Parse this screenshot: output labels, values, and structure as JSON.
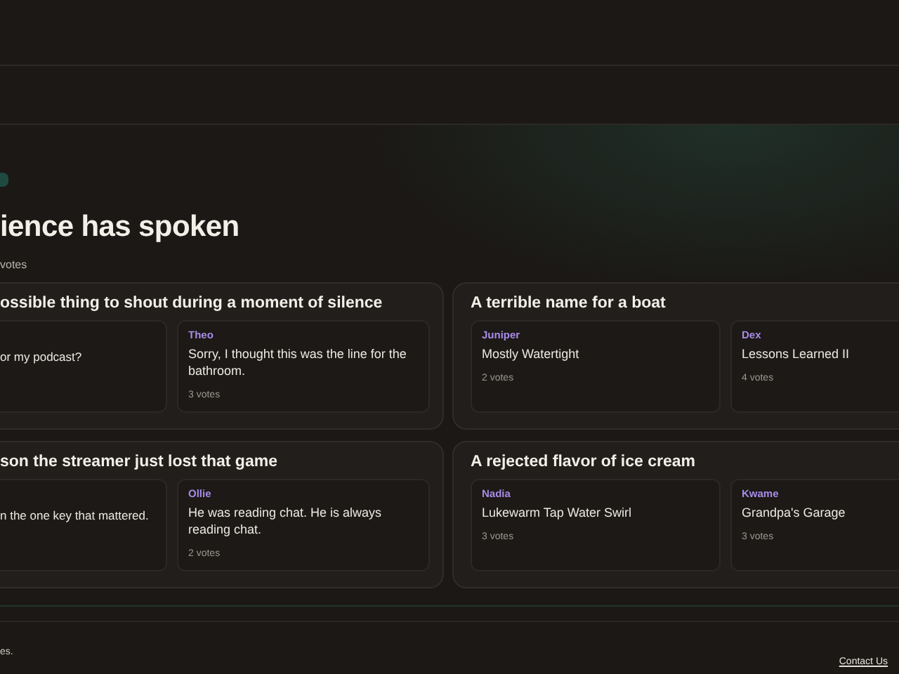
{
  "hero": {
    "title": "ience has spoken",
    "subtitle": "votes"
  },
  "prompts": [
    {
      "title": "ossible thing to shout during a moment of silence",
      "cut": true,
      "answers": [
        {
          "text": "or my podcast?"
        },
        {
          "author": "Theo",
          "text": "Sorry, I thought this was the line for the bathroom.",
          "votes": "3 votes"
        }
      ]
    },
    {
      "title": "A terrible name for a boat",
      "cut": false,
      "answers": [
        {
          "author": "Juniper",
          "text": "Mostly Watertight",
          "votes": "2 votes"
        },
        {
          "author": "Dex",
          "text": "Lessons Learned II",
          "votes": "4 votes"
        }
      ]
    },
    {
      "title": "son the streamer just lost that game",
      "cut": true,
      "answers": [
        {
          "text": "n the one key that mattered."
        },
        {
          "author": "Ollie",
          "text": "He was reading chat. He is always reading chat.",
          "votes": "2 votes"
        }
      ]
    },
    {
      "title": "A rejected flavor of ice cream",
      "cut": false,
      "answers": [
        {
          "author": "Nadia",
          "text": "Lukewarm Tap Water Swirl",
          "votes": "3 votes"
        },
        {
          "author": "Kwame",
          "text": "Grandpa's Garage",
          "votes": "3 votes"
        }
      ]
    }
  ],
  "footer": {
    "note": "es.",
    "link": "Contact Us"
  }
}
